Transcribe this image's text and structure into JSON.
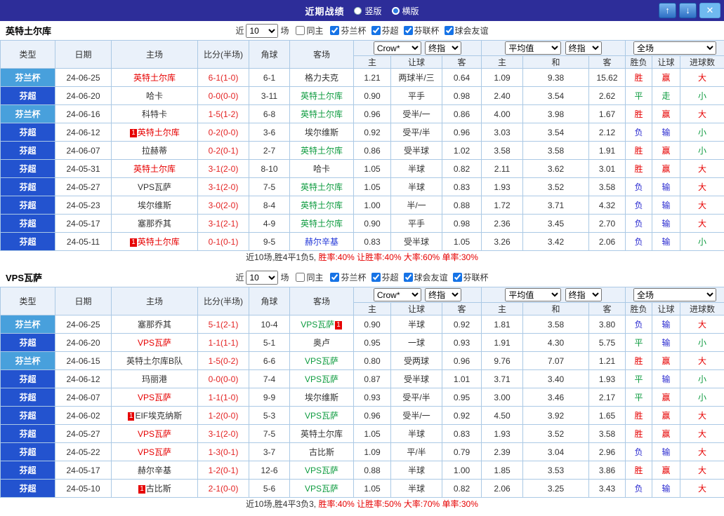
{
  "topbar": {
    "title": "近期战绩",
    "radio_options": [
      {
        "label": "竖版",
        "selected": false
      },
      {
        "label": "横版",
        "selected": true
      }
    ],
    "buttons": {
      "up": "↑",
      "down": "↓",
      "close": "✕"
    },
    "bar_color": "#2d2d99"
  },
  "filter_labels": {
    "near": "近",
    "count": "10",
    "games": "场",
    "same_home": "同主"
  },
  "table_header": {
    "type": "类型",
    "date": "日期",
    "home": "主场",
    "score": "比分(半场)",
    "corner": "角球",
    "away": "客场",
    "bookmaker": "Crow*",
    "final": "终指",
    "average": "平均值",
    "full": "全场",
    "sub": [
      "主",
      "让球",
      "客",
      "主",
      "和",
      "客",
      "胜负",
      "让球",
      "进球数"
    ]
  },
  "colors": {
    "league_badge": "#2353cf",
    "cup_badge": "#48a0dc",
    "win": "#e60000",
    "push": "#0d9b3f",
    "lose": "#2b2bd0",
    "home_team": "#e60000",
    "away_team": "#0d9b3f"
  },
  "sections": [
    {
      "team": "英特土尔库",
      "leagues": [
        "芬兰杯",
        "芬超",
        "芬联杯",
        "球会友谊"
      ],
      "rows": [
        {
          "type": "芬兰杯",
          "tc": "cup",
          "date": "24-06-25",
          "home": {
            "t": "英特土尔库",
            "c": "red"
          },
          "score": "6-1(1-0)",
          "corner": "6-1",
          "away": {
            "t": "格力夫克",
            "c": "black"
          },
          "crow": [
            "1.21",
            "两球半/三",
            "0.64"
          ],
          "avg": [
            "1.09",
            "9.38",
            "15.62"
          ],
          "res": [
            [
              "胜",
              "r"
            ],
            [
              "赢",
              "r"
            ],
            [
              "大",
              "r"
            ]
          ]
        },
        {
          "type": "芬超",
          "tc": "lg",
          "date": "24-06-20",
          "home": {
            "t": "哈卡",
            "c": "black"
          },
          "score": "0-0(0-0)",
          "corner": "3-11",
          "away": {
            "t": "英特土尔库",
            "c": "green"
          },
          "crow": [
            "0.90",
            "平手",
            "0.98"
          ],
          "avg": [
            "2.40",
            "3.54",
            "2.62"
          ],
          "res": [
            [
              "平",
              "g"
            ],
            [
              "走",
              "g"
            ],
            [
              "小",
              "g"
            ]
          ]
        },
        {
          "type": "芬兰杯",
          "tc": "cup",
          "date": "24-06-16",
          "home": {
            "t": "科特卡",
            "c": "black"
          },
          "score": "1-5(1-2)",
          "corner": "6-8",
          "away": {
            "t": "英特土尔库",
            "c": "green"
          },
          "crow": [
            "0.96",
            "受半/一",
            "0.86"
          ],
          "avg": [
            "4.00",
            "3.98",
            "1.67"
          ],
          "res": [
            [
              "胜",
              "r"
            ],
            [
              "赢",
              "r"
            ],
            [
              "大",
              "r"
            ]
          ]
        },
        {
          "type": "芬超",
          "tc": "lg",
          "date": "24-06-12",
          "home": {
            "t": "英特土尔库",
            "c": "red",
            "b1": "1"
          },
          "score": "0-2(0-0)",
          "corner": "3-6",
          "away": {
            "t": "埃尔维斯",
            "c": "black"
          },
          "crow": [
            "0.92",
            "受平/半",
            "0.96"
          ],
          "avg": [
            "3.03",
            "3.54",
            "2.12"
          ],
          "res": [
            [
              "负",
              "b"
            ],
            [
              "输",
              "b"
            ],
            [
              "小",
              "g"
            ]
          ]
        },
        {
          "type": "芬超",
          "tc": "lg",
          "date": "24-06-07",
          "home": {
            "t": "拉赫蒂",
            "c": "black"
          },
          "score": "0-2(0-1)",
          "corner": "2-7",
          "away": {
            "t": "英特土尔库",
            "c": "green"
          },
          "crow": [
            "0.86",
            "受半球",
            "1.02"
          ],
          "avg": [
            "3.58",
            "3.58",
            "1.91"
          ],
          "res": [
            [
              "胜",
              "r"
            ],
            [
              "赢",
              "r"
            ],
            [
              "小",
              "g"
            ]
          ]
        },
        {
          "type": "芬超",
          "tc": "lg",
          "date": "24-05-31",
          "home": {
            "t": "英特土尔库",
            "c": "red"
          },
          "score": "3-1(2-0)",
          "corner": "8-10",
          "away": {
            "t": "哈卡",
            "c": "black"
          },
          "crow": [
            "1.05",
            "半球",
            "0.82"
          ],
          "avg": [
            "2.11",
            "3.62",
            "3.01"
          ],
          "res": [
            [
              "胜",
              "r"
            ],
            [
              "赢",
              "r"
            ],
            [
              "大",
              "r"
            ]
          ]
        },
        {
          "type": "芬超",
          "tc": "lg",
          "date": "24-05-27",
          "home": {
            "t": "VPS瓦萨",
            "c": "black"
          },
          "score": "3-1(2-0)",
          "corner": "7-5",
          "away": {
            "t": "英特土尔库",
            "c": "green"
          },
          "crow": [
            "1.05",
            "半球",
            "0.83"
          ],
          "avg": [
            "1.93",
            "3.52",
            "3.58"
          ],
          "res": [
            [
              "负",
              "b"
            ],
            [
              "输",
              "b"
            ],
            [
              "大",
              "r"
            ]
          ]
        },
        {
          "type": "芬超",
          "tc": "lg",
          "date": "24-05-23",
          "home": {
            "t": "埃尔维斯",
            "c": "black"
          },
          "score": "3-0(2-0)",
          "corner": "8-4",
          "away": {
            "t": "英特土尔库",
            "c": "green"
          },
          "crow": [
            "1.00",
            "半/一",
            "0.88"
          ],
          "avg": [
            "1.72",
            "3.71",
            "4.32"
          ],
          "res": [
            [
              "负",
              "b"
            ],
            [
              "输",
              "b"
            ],
            [
              "大",
              "r"
            ]
          ]
        },
        {
          "type": "芬超",
          "tc": "lg",
          "date": "24-05-17",
          "home": {
            "t": "塞那乔其",
            "c": "black"
          },
          "score": "3-1(2-1)",
          "corner": "4-9",
          "away": {
            "t": "英特土尔库",
            "c": "green"
          },
          "crow": [
            "0.90",
            "平手",
            "0.98"
          ],
          "avg": [
            "2.36",
            "3.45",
            "2.70"
          ],
          "res": [
            [
              "负",
              "b"
            ],
            [
              "输",
              "b"
            ],
            [
              "大",
              "r"
            ]
          ]
        },
        {
          "type": "芬超",
          "tc": "lg",
          "date": "24-05-11",
          "home": {
            "t": "英特土尔库",
            "c": "red",
            "b1": "1"
          },
          "score": "0-1(0-1)",
          "corner": "9-5",
          "away": {
            "t": "赫尔辛基",
            "c": "blue"
          },
          "crow": [
            "0.83",
            "受半球",
            "1.05"
          ],
          "avg": [
            "3.26",
            "3.42",
            "2.06"
          ],
          "res": [
            [
              "负",
              "b"
            ],
            [
              "输",
              "b"
            ],
            [
              "小",
              "g"
            ]
          ]
        }
      ],
      "summary_prefix": "近10场,胜4平1负5, ",
      "summary_stats": "胜率:40% 让胜率:40% 大率:60% 单率:30%"
    },
    {
      "team": "VPS瓦萨",
      "leagues": [
        "芬兰杯",
        "芬超",
        "球会友谊",
        "芬联杯"
      ],
      "rows": [
        {
          "type": "芬兰杯",
          "tc": "cup",
          "date": "24-06-25",
          "home": {
            "t": "塞那乔其",
            "c": "black"
          },
          "score": "5-1(2-1)",
          "corner": "10-4",
          "away": {
            "t": "VPS瓦萨",
            "c": "green",
            "b2": "1"
          },
          "crow": [
            "0.90",
            "半球",
            "0.92"
          ],
          "avg": [
            "1.81",
            "3.58",
            "3.80"
          ],
          "res": [
            [
              "负",
              "b"
            ],
            [
              "输",
              "b"
            ],
            [
              "大",
              "r"
            ]
          ]
        },
        {
          "type": "芬超",
          "tc": "lg",
          "date": "24-06-20",
          "home": {
            "t": "VPS瓦萨",
            "c": "red"
          },
          "score": "1-1(1-1)",
          "corner": "5-1",
          "away": {
            "t": "奥卢",
            "c": "black"
          },
          "crow": [
            "0.95",
            "一球",
            "0.93"
          ],
          "avg": [
            "1.91",
            "4.30",
            "5.75"
          ],
          "res": [
            [
              "平",
              "g"
            ],
            [
              "输",
              "b"
            ],
            [
              "小",
              "g"
            ]
          ]
        },
        {
          "type": "芬兰杯",
          "tc": "cup",
          "date": "24-06-15",
          "home": {
            "t": "英特土尔库B队",
            "c": "black"
          },
          "score": "1-5(0-2)",
          "corner": "6-6",
          "away": {
            "t": "VPS瓦萨",
            "c": "green"
          },
          "crow": [
            "0.80",
            "受两球",
            "0.96"
          ],
          "avg": [
            "9.76",
            "7.07",
            "1.21"
          ],
          "res": [
            [
              "胜",
              "r"
            ],
            [
              "赢",
              "r"
            ],
            [
              "大",
              "r"
            ]
          ]
        },
        {
          "type": "芬超",
          "tc": "lg",
          "date": "24-06-12",
          "home": {
            "t": "玛丽港",
            "c": "black"
          },
          "score": "0-0(0-0)",
          "corner": "7-4",
          "away": {
            "t": "VPS瓦萨",
            "c": "green"
          },
          "crow": [
            "0.87",
            "受半球",
            "1.01"
          ],
          "avg": [
            "3.71",
            "3.40",
            "1.93"
          ],
          "res": [
            [
              "平",
              "g"
            ],
            [
              "输",
              "b"
            ],
            [
              "小",
              "g"
            ]
          ]
        },
        {
          "type": "芬超",
          "tc": "lg",
          "date": "24-06-07",
          "home": {
            "t": "VPS瓦萨",
            "c": "red"
          },
          "score": "1-1(1-0)",
          "corner": "9-9",
          "away": {
            "t": "埃尔维斯",
            "c": "black"
          },
          "crow": [
            "0.93",
            "受平/半",
            "0.95"
          ],
          "avg": [
            "3.00",
            "3.46",
            "2.17"
          ],
          "res": [
            [
              "平",
              "g"
            ],
            [
              "赢",
              "r"
            ],
            [
              "小",
              "g"
            ]
          ]
        },
        {
          "type": "芬超",
          "tc": "lg",
          "date": "24-06-02",
          "home": {
            "t": "EIF埃克纳斯",
            "c": "black",
            "b1": "1"
          },
          "score": "1-2(0-0)",
          "corner": "5-3",
          "away": {
            "t": "VPS瓦萨",
            "c": "green"
          },
          "crow": [
            "0.96",
            "受半/一",
            "0.92"
          ],
          "avg": [
            "4.50",
            "3.92",
            "1.65"
          ],
          "res": [
            [
              "胜",
              "r"
            ],
            [
              "赢",
              "r"
            ],
            [
              "大",
              "r"
            ]
          ]
        },
        {
          "type": "芬超",
          "tc": "lg",
          "date": "24-05-27",
          "home": {
            "t": "VPS瓦萨",
            "c": "red"
          },
          "score": "3-1(2-0)",
          "corner": "7-5",
          "away": {
            "t": "英特土尔库",
            "c": "black"
          },
          "crow": [
            "1.05",
            "半球",
            "0.83"
          ],
          "avg": [
            "1.93",
            "3.52",
            "3.58"
          ],
          "res": [
            [
              "胜",
              "r"
            ],
            [
              "赢",
              "r"
            ],
            [
              "大",
              "r"
            ]
          ]
        },
        {
          "type": "芬超",
          "tc": "lg",
          "date": "24-05-22",
          "home": {
            "t": "VPS瓦萨",
            "c": "red"
          },
          "score": "1-3(0-1)",
          "corner": "3-7",
          "away": {
            "t": "古比斯",
            "c": "black"
          },
          "crow": [
            "1.09",
            "平/半",
            "0.79"
          ],
          "avg": [
            "2.39",
            "3.04",
            "2.96"
          ],
          "res": [
            [
              "负",
              "b"
            ],
            [
              "输",
              "b"
            ],
            [
              "大",
              "r"
            ]
          ]
        },
        {
          "type": "芬超",
          "tc": "lg",
          "date": "24-05-17",
          "home": {
            "t": "赫尔辛基",
            "c": "black"
          },
          "score": "1-2(0-1)",
          "corner": "12-6",
          "away": {
            "t": "VPS瓦萨",
            "c": "green"
          },
          "crow": [
            "0.88",
            "半球",
            "1.00"
          ],
          "avg": [
            "1.85",
            "3.53",
            "3.86"
          ],
          "res": [
            [
              "胜",
              "r"
            ],
            [
              "赢",
              "r"
            ],
            [
              "大",
              "r"
            ]
          ]
        },
        {
          "type": "芬超",
          "tc": "lg",
          "date": "24-05-10",
          "home": {
            "t": "古比斯",
            "c": "black",
            "b1": "1"
          },
          "score": "2-1(0-0)",
          "corner": "5-6",
          "away": {
            "t": "VPS瓦萨",
            "c": "green"
          },
          "crow": [
            "1.05",
            "半球",
            "0.82"
          ],
          "avg": [
            "2.06",
            "3.25",
            "3.43"
          ],
          "res": [
            [
              "负",
              "b"
            ],
            [
              "输",
              "b"
            ],
            [
              "大",
              "r"
            ]
          ]
        }
      ],
      "summary_prefix": "近10场,胜4平3负3, ",
      "summary_stats": "胜率:40% 让胜率:50% 大率:70% 单率:30%"
    }
  ]
}
